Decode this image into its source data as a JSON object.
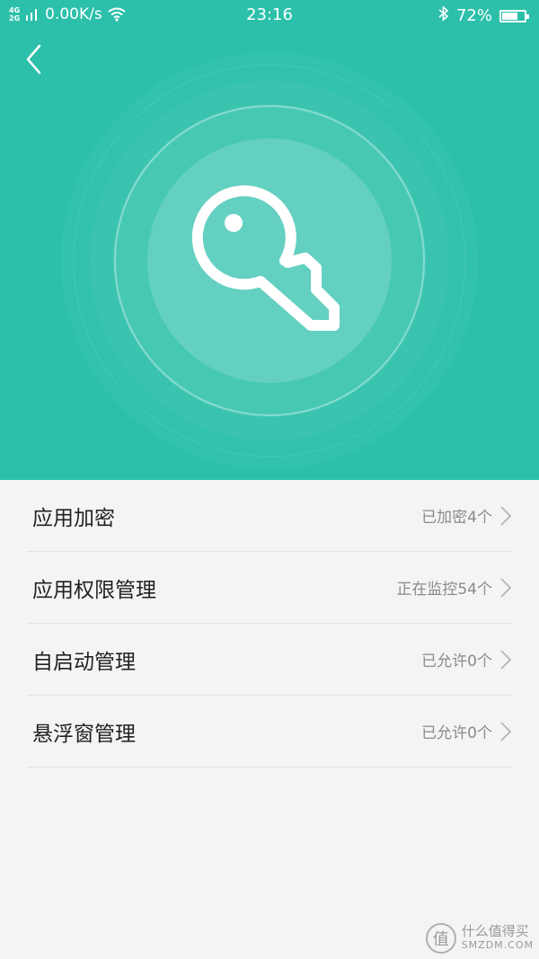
{
  "status_bar": {
    "network_type_top": "4G",
    "network_type_bottom": "2G",
    "speed": "0.00K/s",
    "time": "23:16",
    "battery": "72%",
    "battery_level": 0.72,
    "icons": [
      "signal-icon",
      "wifi-icon",
      "bluetooth-icon",
      "battery-icon"
    ]
  },
  "header": {
    "color": "#2cc0ab",
    "back_icon": "chevron-left-icon",
    "hero_icon": "key-icon"
  },
  "list": {
    "items": [
      {
        "label": "应用加密",
        "status": "已加密4个"
      },
      {
        "label": "应用权限管理",
        "status": "正在监控54个"
      },
      {
        "label": "自启动管理",
        "status": "已允许0个"
      },
      {
        "label": "悬浮窗管理",
        "status": "已允许0个"
      }
    ]
  },
  "watermark": {
    "logo": "值",
    "name": "什么值得买",
    "site": "SMZDM.COM"
  }
}
